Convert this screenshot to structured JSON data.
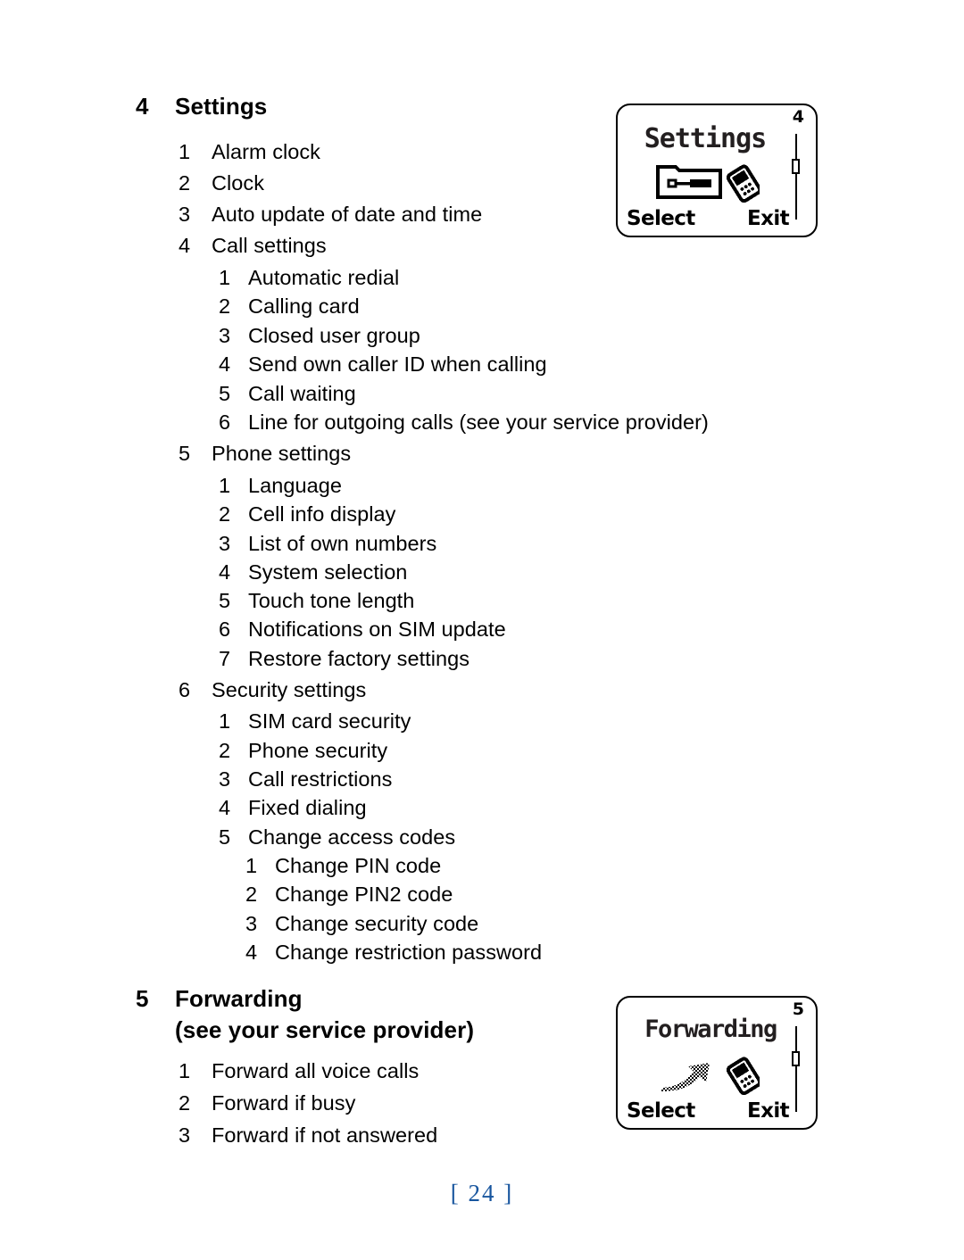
{
  "page": {
    "folio": "[ 24 ]",
    "folio_color": "#17559e"
  },
  "sections": [
    {
      "number": "4",
      "title": "Settings",
      "subtitle": ""
    },
    {
      "number": "5",
      "title": "Forwarding",
      "subtitle": "(see your service provider)"
    }
  ],
  "settings_list": {
    "items": [
      {
        "num": "1",
        "label": "Alarm clock"
      },
      {
        "num": "2",
        "label": "Clock"
      },
      {
        "num": "3",
        "label": "Auto update of date and time"
      },
      {
        "num": "4",
        "label": "Call settings"
      }
    ],
    "call_settings": [
      {
        "num": "1",
        "label": "Automatic redial"
      },
      {
        "num": "2",
        "label": "Calling card"
      },
      {
        "num": "3",
        "label": "Closed user group"
      },
      {
        "num": "4",
        "label": "Send own caller ID when calling"
      },
      {
        "num": "5",
        "label": "Call waiting"
      },
      {
        "num": "6",
        "label": "Line for outgoing calls (see your service provider)"
      }
    ],
    "phone_settings_header": {
      "num": "5",
      "label": "Phone settings"
    },
    "phone_settings": [
      {
        "num": "1",
        "label": "Language"
      },
      {
        "num": "2",
        "label": "Cell info display"
      },
      {
        "num": "3",
        "label": "List of own numbers"
      },
      {
        "num": "4",
        "label": "System selection"
      },
      {
        "num": "5",
        "label": "Touch tone length"
      },
      {
        "num": "6",
        "label": "Notifications on SIM update"
      },
      {
        "num": "7",
        "label": "Restore factory settings"
      }
    ],
    "security_settings_header": {
      "num": "6",
      "label": "Security settings"
    },
    "security_settings": [
      {
        "num": "1",
        "label": "SIM card security"
      },
      {
        "num": "2",
        "label": "Phone security"
      },
      {
        "num": "3",
        "label": "Call restrictions"
      },
      {
        "num": "4",
        "label": "Fixed dialing"
      },
      {
        "num": "5",
        "label": "Change access codes"
      }
    ],
    "change_access_codes": [
      {
        "num": "1",
        "label": "Change PIN code"
      },
      {
        "num": "2",
        "label": "Change PIN2 code"
      },
      {
        "num": "3",
        "label": "Change security code"
      },
      {
        "num": "4",
        "label": "Change restriction password"
      }
    ]
  },
  "forwarding_list": [
    {
      "num": "1",
      "label": "Forward all voice calls"
    },
    {
      "num": "2",
      "label": "Forward if busy"
    },
    {
      "num": "3",
      "label": "Forward if not answered"
    }
  ],
  "screens": [
    {
      "title": "Settings",
      "scroll_index": "4",
      "softkey_left": "Select",
      "softkey_right": "Exit",
      "icon": "tools-settings-icon"
    },
    {
      "title": "Forwarding",
      "scroll_index": "5",
      "softkey_left": "Select",
      "softkey_right": "Exit",
      "icon": "call-forward-arrow-icon"
    }
  ]
}
